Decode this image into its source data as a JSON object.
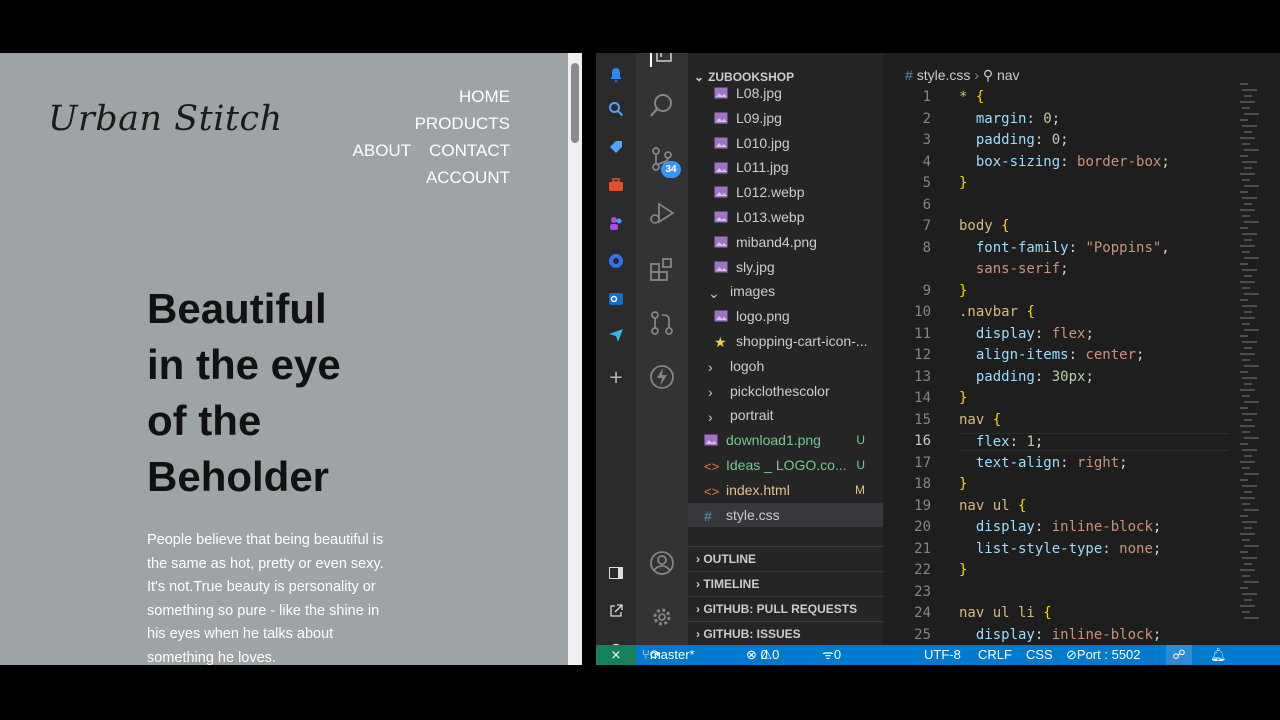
{
  "website": {
    "logo_text": "Urban Stitch",
    "nav": [
      "HOME",
      "PRODUCTS",
      "ABOUT",
      "CONTACT",
      "ACCOUNT"
    ],
    "hero_lines": [
      "Beautiful",
      "in the eye",
      "of the",
      "Beholder"
    ],
    "description_lines": [
      "People believe that being beautiful is",
      "the same as hot, pretty or even sexy.",
      "It's not.True beauty is personality or",
      "something so pure - like the shine in",
      "his eyes when he talks about",
      "something he loves."
    ]
  },
  "explorer": {
    "root": "ZUBOOKSHOP",
    "files": [
      {
        "name": "L08.jpg",
        "type": "image",
        "indent": 2
      },
      {
        "name": "L09.jpg",
        "type": "image",
        "indent": 2
      },
      {
        "name": "L010.jpg",
        "type": "image",
        "indent": 2
      },
      {
        "name": "L011.jpg",
        "type": "image",
        "indent": 2
      },
      {
        "name": "L012.webp",
        "type": "image",
        "indent": 2
      },
      {
        "name": "L013.webp",
        "type": "image",
        "indent": 2
      },
      {
        "name": "miband4.png",
        "type": "image",
        "indent": 2
      },
      {
        "name": "sly.jpg",
        "type": "image",
        "indent": 2
      },
      {
        "name": "images",
        "type": "folder-open",
        "indent": 1
      },
      {
        "name": "logo.png",
        "type": "image",
        "indent": 2
      },
      {
        "name": "shopping-cart-icon-...",
        "type": "star",
        "indent": 2
      },
      {
        "name": "logoh",
        "type": "folder",
        "indent": 1
      },
      {
        "name": "pickclothescolor",
        "type": "folder",
        "indent": 1
      },
      {
        "name": "portrait",
        "type": "folder",
        "indent": 1
      },
      {
        "name": "download1.png",
        "type": "image",
        "indent": 0,
        "status": "U",
        "color": "#73c991"
      },
      {
        "name": "Ideas _ LOGO.co...",
        "type": "html",
        "indent": 0,
        "status": "U",
        "color": "#73c991"
      },
      {
        "name": "index.html",
        "type": "html",
        "indent": 0,
        "status": "M",
        "color": "#e2c08d"
      },
      {
        "name": "style.css",
        "type": "css",
        "indent": 0,
        "selected": true
      }
    ],
    "sections": [
      "OUTLINE",
      "TIMELINE",
      "GITHUB: PULL REQUESTS",
      "GITHUB: ISSUES"
    ]
  },
  "editor": {
    "breadcrumb_file": "style.css",
    "breadcrumb_symbol": "nav",
    "lines": [
      {
        "n": "1",
        "html": "<span class='sel'>*</span> <span class='brc'>{</span>"
      },
      {
        "n": "2",
        "html": "  <span class='prop'>margin</span>: <span class='num'>0</span>;"
      },
      {
        "n": "3",
        "html": "  <span class='prop'>padding</span>: <span class='num'>0</span>;"
      },
      {
        "n": "4",
        "html": "  <span class='prop'>box-sizing</span>: <span class='val'>border-box</span>;"
      },
      {
        "n": "5",
        "html": "<span class='brc'>}</span>"
      },
      {
        "n": "6",
        "html": ""
      },
      {
        "n": "7",
        "html": "<span class='sel'>body</span> <span class='brc'>{</span>"
      },
      {
        "n": "8",
        "html": "  <span class='prop'>font-family</span>: <span class='val'>\"Poppins\"</span>,"
      },
      {
        "n": "",
        "html": "  <span class='val'>sans-serif</span>;"
      },
      {
        "n": "9",
        "html": "<span class='brc'>}</span>"
      },
      {
        "n": "10",
        "html": "<span class='sel'>.navbar</span> <span class='brc'>{</span>"
      },
      {
        "n": "11",
        "html": "  <span class='prop'>display</span>: <span class='val'>flex</span>;"
      },
      {
        "n": "12",
        "html": "  <span class='prop'>align-items</span>: <span class='val'>center</span>;"
      },
      {
        "n": "13",
        "html": "  <span class='prop'>padding</span>: <span class='num'>30px</span>;"
      },
      {
        "n": "14",
        "html": "<span class='brc'>}</span>"
      },
      {
        "n": "15",
        "html": "<span class='sel'>nav</span> <span class='brc'>{</span>"
      },
      {
        "n": "16",
        "html": "  <span class='prop'>flex</span>: <span class='num'>1</span>;"
      },
      {
        "n": "17",
        "html": "  <span class='prop'>text-align</span>: <span class='val'>right</span>;"
      },
      {
        "n": "18",
        "html": "<span class='brc'>}</span>"
      },
      {
        "n": "19",
        "html": "<span class='sel'>nav ul</span> <span class='brc'>{</span>"
      },
      {
        "n": "20",
        "html": "  <span class='prop'>display</span>: <span class='val'>inline-block</span>;"
      },
      {
        "n": "21",
        "html": "  <span class='prop'>list-style-type</span>: <span class='val'>none</span>;"
      },
      {
        "n": "22",
        "html": "<span class='brc'>}</span>"
      },
      {
        "n": "23",
        "html": ""
      },
      {
        "n": "24",
        "html": "<span class='sel'>nav ul li</span> <span class='brc'>{</span>"
      },
      {
        "n": "25",
        "html": "  <span class='prop'>display</span>: <span class='val'>inline-block</span>;"
      }
    ],
    "active_line": "16"
  },
  "activity": {
    "scm_badge": "34"
  },
  "statusbar": {
    "branch": "master*",
    "errors": "0",
    "warnings": "0",
    "ports": "0",
    "encoding": "UTF-8",
    "eol": "CRLF",
    "language": "CSS",
    "port": "Port : 5502"
  },
  "colors": {
    "accent": "#007acc",
    "site_bg": "#9ea3a6",
    "editor_bg": "#1e1e1e"
  }
}
